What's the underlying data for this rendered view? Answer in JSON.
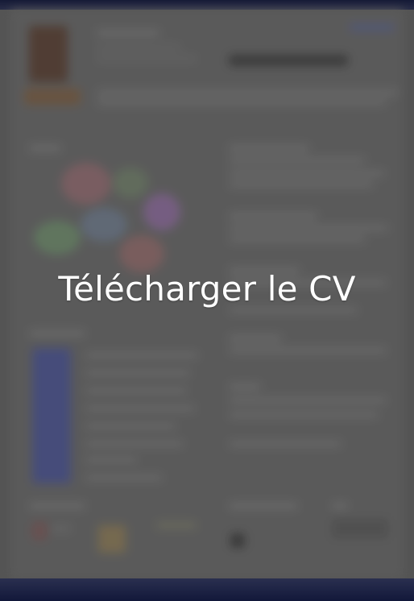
{
  "download": {
    "label": "Télécharger le CV"
  },
  "colors": {
    "top_bar": "#1a1f42",
    "overlay": "#5f5f5f",
    "text": "#ffffff"
  }
}
